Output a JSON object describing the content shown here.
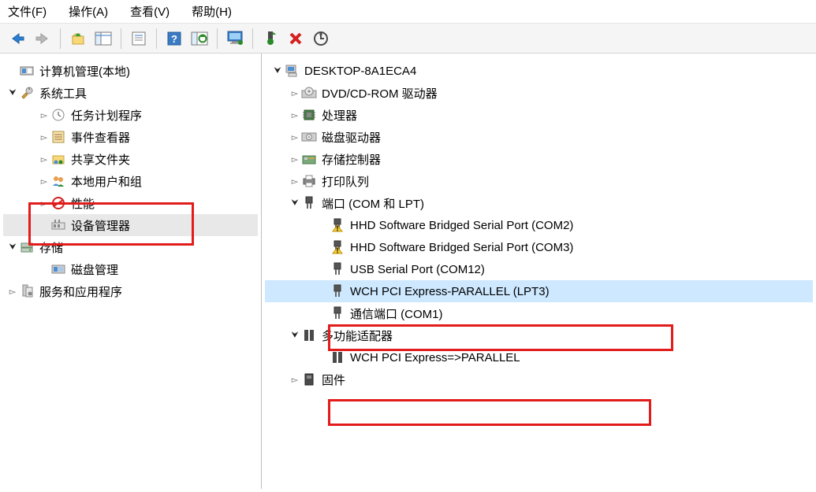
{
  "menu": {
    "file": "文件(F)",
    "action": "操作(A)",
    "view": "查看(V)",
    "help": "帮助(H)"
  },
  "leftTree": {
    "root": "计算机管理(本地)",
    "sysTools": "系统工具",
    "taskScheduler": "任务计划程序",
    "eventViewer": "事件查看器",
    "sharedFolders": "共享文件夹",
    "localUsers": "本地用户和组",
    "performance": "性能",
    "deviceManager": "设备管理器",
    "storage": "存储",
    "diskMgmt": "磁盘管理",
    "services": "服务和应用程序"
  },
  "rightTree": {
    "computer": "DESKTOP-8A1ECA4",
    "dvd": "DVD/CD-ROM 驱动器",
    "cpu": "处理器",
    "disk": "磁盘驱动器",
    "storage": "存储控制器",
    "printQueue": "打印队列",
    "ports": "端口 (COM 和 LPT)",
    "port1": "HHD Software Bridged Serial Port (COM2)",
    "port2": "HHD Software Bridged Serial Port (COM3)",
    "port3": "USB Serial Port (COM12)",
    "port4": "WCH PCI Express-PARALLEL (LPT3)",
    "port5": "通信端口 (COM1)",
    "multifunc": "多功能适配器",
    "wchParallel": "WCH PCI Express=>PARALLEL",
    "firmware": "固件"
  }
}
